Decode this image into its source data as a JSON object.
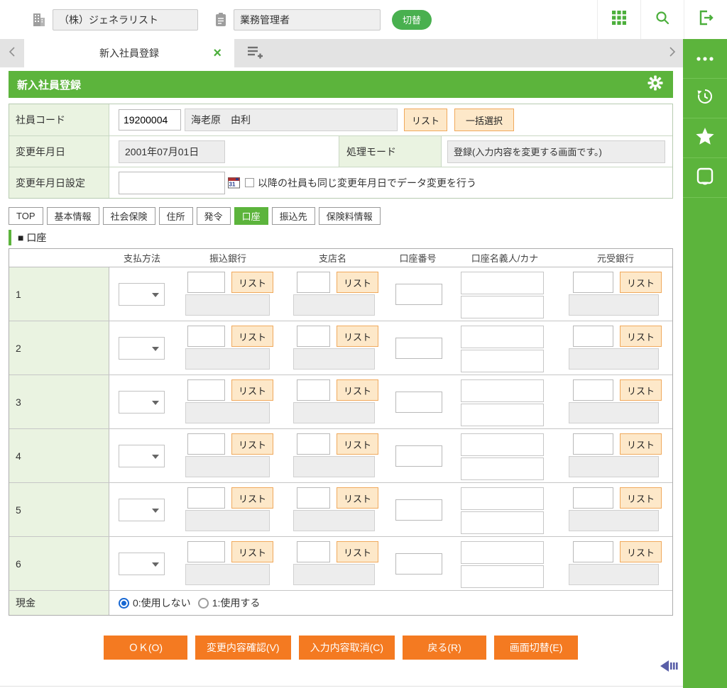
{
  "colors": {
    "green": "#5cb43c",
    "pill_green": "#49b04f",
    "orange": "#f47a21",
    "peach_button_bg": "#fde8c9",
    "peach_button_border": "#f0a95c",
    "label_cell_bg": "#eaf3e1",
    "radio_selected": "#1767d2"
  },
  "top_bar": {
    "company_icon": "building-icon",
    "company_value": "（株）ジェネラリスト",
    "role_icon": "clipboard-icon",
    "role_value": "業務管理者",
    "switch_button_label": "切替",
    "right_icons": [
      "apps-grid-icon",
      "search-icon",
      "logout-icon"
    ]
  },
  "tab_strip": {
    "active_tab_label": "新入社員登録",
    "close_glyph": "×"
  },
  "right_sidebar": {
    "items": [
      "ellipsis-icon",
      "history-icon",
      "star-icon",
      "memo-icon"
    ]
  },
  "page": {
    "title": "新入社員登録"
  },
  "employee_form": {
    "employee_code_label": "社員コード",
    "employee_code_value": "19200004",
    "employee_name_value": "海老原　由利",
    "list_button_label": "リスト",
    "bulk_select_button_label": "一括選択",
    "change_date_label": "変更年月日",
    "change_date_value": "2001年07月01日",
    "process_mode_label": "処理モード",
    "process_mode_value": "登録(入力内容を変更する画面です。)",
    "change_date_setting_label": "変更年月日設定",
    "change_date_setting_value": "",
    "apply_following_checkbox_label": "以降の社員も同じ変更年月日でデータ変更を行う",
    "checkbox_checked": false
  },
  "subtabs": {
    "items": [
      "TOP",
      "基本情報",
      "社会保険",
      "住所",
      "発令",
      "口座",
      "振込先",
      "保険料情報"
    ],
    "active_index": 5
  },
  "section": {
    "title": "■ 口座"
  },
  "accounts_table": {
    "column_headers": [
      "支払方法",
      "振込銀行",
      "支店名",
      "口座番号",
      "口座名義人/カナ",
      "元受銀行"
    ],
    "row_numbers": [
      "1",
      "2",
      "3",
      "4",
      "5",
      "6"
    ],
    "list_button_label": "リスト",
    "cash_row": {
      "label": "現金",
      "options": [
        {
          "label": "0:使用しない",
          "selected": true
        },
        {
          "label": "1:使用する",
          "selected": false
        }
      ]
    }
  },
  "action_buttons": [
    {
      "label": "ＯＫ(O)",
      "name": "ok-button"
    },
    {
      "label": "変更内容確認(V)",
      "name": "confirm-changes-button"
    },
    {
      "label": "入力内容取消(C)",
      "name": "cancel-input-button"
    },
    {
      "label": "戻る(R)",
      "name": "back-button"
    },
    {
      "label": "画面切替(E)",
      "name": "switch-screen-button"
    }
  ]
}
